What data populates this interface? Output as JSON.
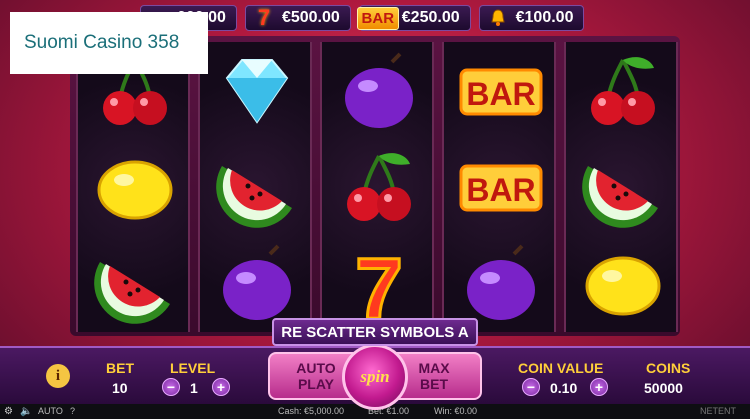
{
  "logo": {
    "text": "Suomi Casino 358"
  },
  "jackpots": [
    {
      "icon": "diamond-icon",
      "value": "€1,000.00",
      "display": "000.00"
    },
    {
      "icon": "seven-icon",
      "value": "€500.00",
      "symbol": "7"
    },
    {
      "icon": "bar-icon",
      "value": "€250.00",
      "symbol": "BAR"
    },
    {
      "icon": "bell-icon",
      "value": "€100.00"
    }
  ],
  "reels": [
    [
      "cherry",
      "lemon",
      "watermelon"
    ],
    [
      "diamond",
      "watermelon",
      "plum"
    ],
    [
      "plum",
      "cherry",
      "seven"
    ],
    [
      "bar",
      "bar",
      "plum"
    ],
    [
      "cherry",
      "watermelon",
      "lemon"
    ]
  ],
  "ticker": {
    "text": "RE SCATTER SYMBOLS A"
  },
  "controls": {
    "info": "i",
    "bet_label": "BET",
    "bet_value": "10",
    "level_label": "LEVEL",
    "level_value": "1",
    "minus": "−",
    "plus": "+",
    "autoplay_line1": "AUTO",
    "autoplay_line2": "PLAY",
    "spin_label": "spin",
    "maxbet_line1": "MAX",
    "maxbet_line2": "BET",
    "coin_value_label": "COIN VALUE",
    "coin_value": "0.10",
    "coins_label": "COINS",
    "coins_value": "50000"
  },
  "footer": {
    "auto_label": "AUTO",
    "help": "?",
    "cash": "Cash: €5,000.00",
    "bet": "Bet: €1.00",
    "win": "Win: €0.00",
    "brand": "NETENT"
  },
  "colors": {
    "background": "#b1193f",
    "panel": "#4b1962",
    "label_gold": "#ffcf3a",
    "logo_text": "#1b6f79"
  }
}
